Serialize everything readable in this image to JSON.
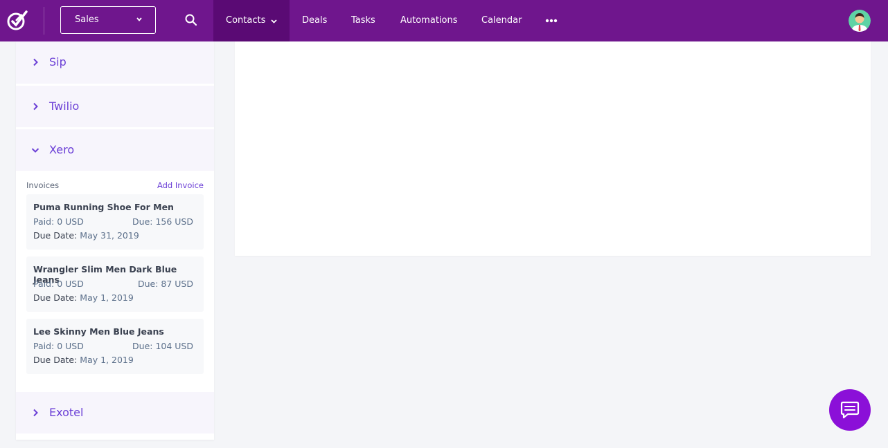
{
  "topbar": {
    "pipeline": "Sales",
    "nav": [
      "Contacts",
      "Deals",
      "Tasks",
      "Automations",
      "Calendar"
    ]
  },
  "sidebar": {
    "sections": [
      "Sip",
      "Twilio",
      "Xero",
      "Exotel"
    ],
    "xero": {
      "invoices_label": "Invoices",
      "add_invoice": "Add Invoice",
      "due_date_label": "Due Date:",
      "invoices": [
        {
          "title": "Puma Running Shoe For Men",
          "paid": "Paid: 0 USD",
          "due": "Due: 156 USD",
          "date": "May 31, 2019"
        },
        {
          "title": "Wrangler Slim Men Dark Blue Jeans",
          "paid": "Paid: 0 USD",
          "due": "Due: 87 USD",
          "date": "May 1, 2019"
        },
        {
          "title": "Lee Skinny Men Blue Jeans",
          "paid": "Paid: 0 USD",
          "due": "Due: 104 USD",
          "date": "May 1, 2019"
        }
      ]
    }
  },
  "colors": {
    "topbar": "#6f168d",
    "accent": "#6b3fd6",
    "chat": "#8b10d8"
  },
  "icons": [
    "logo-icon",
    "chevron-down-icon",
    "search-icon",
    "more-icon",
    "avatar",
    "chevron-right-icon",
    "chat-icon"
  ]
}
